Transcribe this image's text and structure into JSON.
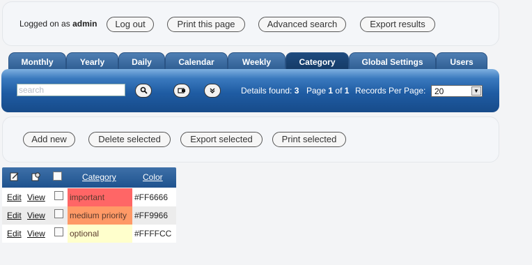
{
  "header": {
    "logged_prefix": "Logged on as",
    "username": "admin",
    "buttons": [
      "Log out",
      "Print this page",
      "Advanced search",
      "Export results"
    ]
  },
  "tabs": [
    {
      "label": "Monthly",
      "active": false
    },
    {
      "label": "Yearly",
      "active": false
    },
    {
      "label": "Daily",
      "active": false
    },
    {
      "label": "Calendar",
      "active": false
    },
    {
      "label": "Weekly",
      "active": false
    },
    {
      "label": "Category",
      "active": true
    },
    {
      "label": "Global Settings",
      "active": false
    },
    {
      "label": "Users",
      "active": false
    }
  ],
  "toolbar": {
    "search_placeholder": "search",
    "details_label": "Details found:",
    "details_count": "3",
    "page_label": "Page",
    "page_current": "1",
    "page_of": "of",
    "page_total": "1",
    "rpp_label": "Records Per Page:",
    "rpp_value": "20"
  },
  "actions": [
    "Add new",
    "Delete selected",
    "Export selected",
    "Print selected"
  ],
  "table": {
    "headers": {
      "category": "Category",
      "color": "Color"
    },
    "edit_label": "Edit",
    "view_label": "View",
    "rows": [
      {
        "category": "important",
        "color": "#FF6666"
      },
      {
        "category": "medium priority",
        "color": "#FF9966"
      },
      {
        "category": "optional",
        "color": "#FFFFCC"
      }
    ]
  }
}
